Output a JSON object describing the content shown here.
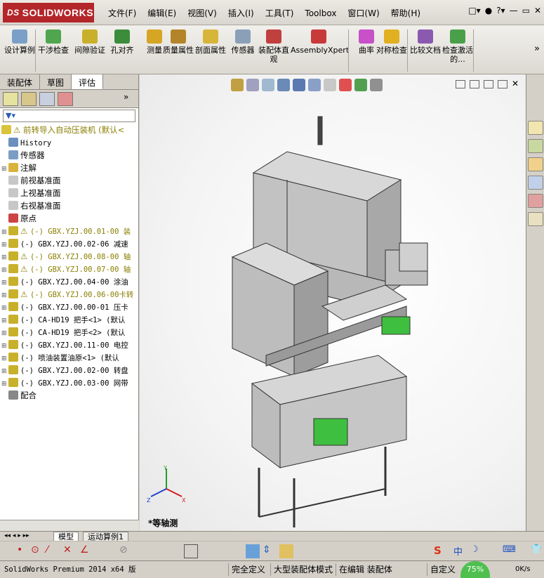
{
  "app": {
    "logo": "SOLIDWORKS",
    "logo_prefix": "DS"
  },
  "menu": [
    "文件(F)",
    "编辑(E)",
    "视图(V)",
    "插入(I)",
    "工具(T)",
    "Toolbox",
    "窗口(W)",
    "帮助(H)"
  ],
  "ribbon": [
    {
      "label": "设计算例",
      "icon": "design-study-icon",
      "color": "#7aa0c8"
    },
    {
      "label": "干涉检查",
      "icon": "interference-icon",
      "color": "#4fa64f"
    },
    {
      "label": "间隙验证",
      "icon": "clearance-icon",
      "color": "#c9b02a"
    },
    {
      "label": "孔对齐",
      "icon": "hole-align-icon",
      "color": "#3b8d3b"
    },
    {
      "label": "测量",
      "icon": "measure-icon",
      "color": "#d7a524"
    },
    {
      "label": "质量属性",
      "icon": "mass-properties-icon",
      "color": "#b4842a"
    },
    {
      "label": "剖面属性",
      "icon": "section-properties-icon",
      "color": "#d6b53a"
    },
    {
      "label": "传感器",
      "icon": "sensor-icon",
      "color": "#8aa0b8"
    },
    {
      "label": "装配体直观",
      "icon": "assembly-visualization-icon",
      "color": "#c04040"
    },
    {
      "label": "AssemblyXpert",
      "icon": "assemblyxpert-icon",
      "color": "#c83a3a"
    },
    {
      "label": "曲率",
      "icon": "curvature-icon",
      "color": "#c850c8"
    },
    {
      "label": "对称检查",
      "icon": "symmetry-check-icon",
      "color": "#e0b020"
    },
    {
      "label": "比较文档",
      "icon": "compare-documents-icon",
      "color": "#8a5ab0"
    },
    {
      "label": "检查激活的...",
      "icon": "check-active-icon",
      "color": "#4aa04a"
    }
  ],
  "pane_tabs": [
    "装配体",
    "草图",
    "评估"
  ],
  "tree": {
    "root": "前转导入自动压装机  (默认<",
    "items": [
      {
        "label": "History",
        "mono": true,
        "icon": "history-icon",
        "color": "#6d8fbf"
      },
      {
        "label": "传感器",
        "icon": "sensor-icon",
        "color": "#7b9cc5"
      },
      {
        "label": "注解",
        "icon": "annotation-icon",
        "color": "#d9b33b",
        "toggle": "+"
      },
      {
        "label": "前视基准面",
        "icon": "plane-icon",
        "color": "#c7c7c7"
      },
      {
        "label": "上视基准面",
        "icon": "plane-icon",
        "color": "#c7c7c7"
      },
      {
        "label": "右视基准面",
        "icon": "plane-icon",
        "color": "#c7c7c7"
      },
      {
        "label": "原点",
        "icon": "origin-icon",
        "color": "#cc4444"
      },
      {
        "label": "(-) GBX.YZJ.00.01-00 装",
        "mono": true,
        "warn": true,
        "toggle": "+",
        "icon": "subassembly-icon",
        "color": "#c9b02a"
      },
      {
        "label": "(-) GBX.YZJ.00.02-06 减速",
        "mono": true,
        "toggle": "+",
        "icon": "subassembly-icon",
        "color": "#c9b02a"
      },
      {
        "label": "(-) GBX.YZJ.00.08-00 轴",
        "mono": true,
        "warn": true,
        "toggle": "+",
        "icon": "subassembly-icon",
        "color": "#c9b02a"
      },
      {
        "label": "(-) GBX.YZJ.00.07-00 轴",
        "mono": true,
        "warn": true,
        "toggle": "+",
        "icon": "subassembly-icon",
        "color": "#c9b02a"
      },
      {
        "label": "(-) GBX.YZJ.00.04-00 涂油",
        "mono": true,
        "toggle": "+",
        "icon": "subassembly-icon",
        "color": "#c9b02a"
      },
      {
        "label": "(-) GBX.YZJ.00.06-00卡转",
        "mono": true,
        "warn": true,
        "toggle": "+",
        "icon": "subassembly-icon",
        "color": "#c9b02a"
      },
      {
        "label": "(-) GBX.YZJ.00.00-01 压卡",
        "mono": true,
        "toggle": "+",
        "icon": "subassembly-icon",
        "color": "#c9b02a"
      },
      {
        "label": "(-) CA-HD19 把手<1> (默认",
        "mono": true,
        "toggle": "+",
        "icon": "subassembly-icon",
        "color": "#c9b02a"
      },
      {
        "label": "(-) CA-HD19 把手<2> (默认",
        "mono": true,
        "toggle": "+",
        "icon": "subassembly-icon",
        "color": "#c9b02a"
      },
      {
        "label": "(-) GBX.YZJ.00.11-00 电控",
        "mono": true,
        "toggle": "+",
        "icon": "subassembly-icon",
        "color": "#c9b02a"
      },
      {
        "label": "(-) 喷油装置油原<1> (默认",
        "mono": true,
        "toggle": "+",
        "icon": "subassembly-icon",
        "color": "#c9b02a"
      },
      {
        "label": "(-) GBX.YZJ.00.02-00 转盘",
        "mono": true,
        "toggle": "+",
        "icon": "subassembly-icon",
        "color": "#c9b02a"
      },
      {
        "label": "(-) GBX.YZJ.00.03-00 网带",
        "mono": true,
        "toggle": "+",
        "icon": "subassembly-icon",
        "color": "#c9b02a"
      },
      {
        "label": "配合",
        "icon": "mates-icon",
        "color": "#888888"
      }
    ]
  },
  "viewport": {
    "view_label": "*等轴测"
  },
  "bottom_tabs": [
    "模型",
    "运动算例1"
  ],
  "status": {
    "product": "SolidWorks Premium 2014 x64 版",
    "definition": "完全定义",
    "mode": "大型装配体模式",
    "editing": "在编辑 装配体",
    "custom": "自定义",
    "progress": "75%",
    "speed": "0K/s"
  },
  "colors": {
    "accent": "#b3262a",
    "bg": "#d4d0c8"
  }
}
